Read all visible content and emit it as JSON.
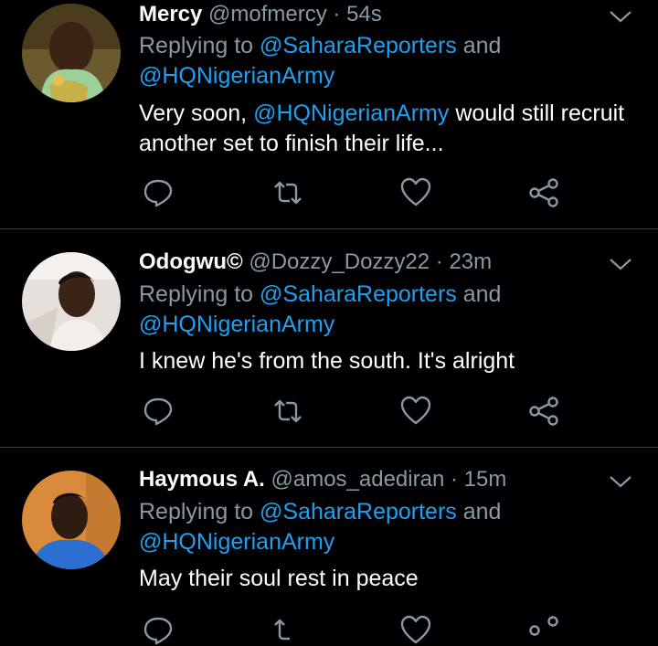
{
  "tweets": [
    {
      "name": "Mercy",
      "handle": "@mofmercy",
      "separator": "·",
      "time": "54s",
      "replying_prefix": "Replying to ",
      "mention1": "@SaharaReporters",
      "and": " and",
      "mention2": "@HQNigerianArmy",
      "text_before": "Very soon, ",
      "text_mention": "@HQNigerianArmy",
      "text_after_1": " would still recruit",
      "text_line2": "another set to finish their life..."
    },
    {
      "name": "Odogwu©",
      "handle": "@Dozzy_Dozzy22",
      "separator": "·",
      "time": "23m",
      "replying_prefix": "Replying to ",
      "mention1": "@SaharaReporters",
      "and": " and",
      "mention2": "@HQNigerianArmy",
      "text": "I knew he's from the south. It's alright"
    },
    {
      "name": "Haymous A.",
      "handle": "@amos_adediran",
      "separator": "·",
      "time": "15m",
      "replying_prefix": "Replying to ",
      "mention1": "@SaharaReporters",
      "and": " and",
      "mention2": "@HQNigerianArmy",
      "text": "May their soul rest in peace"
    }
  ],
  "icons": [
    "reply-icon",
    "retweet-icon",
    "like-icon",
    "share-icon",
    "caret-down-icon"
  ],
  "colors": {
    "background": "#000000",
    "muted": "#8899a6",
    "link": "#1da1f2",
    "divider": "#38444d"
  }
}
